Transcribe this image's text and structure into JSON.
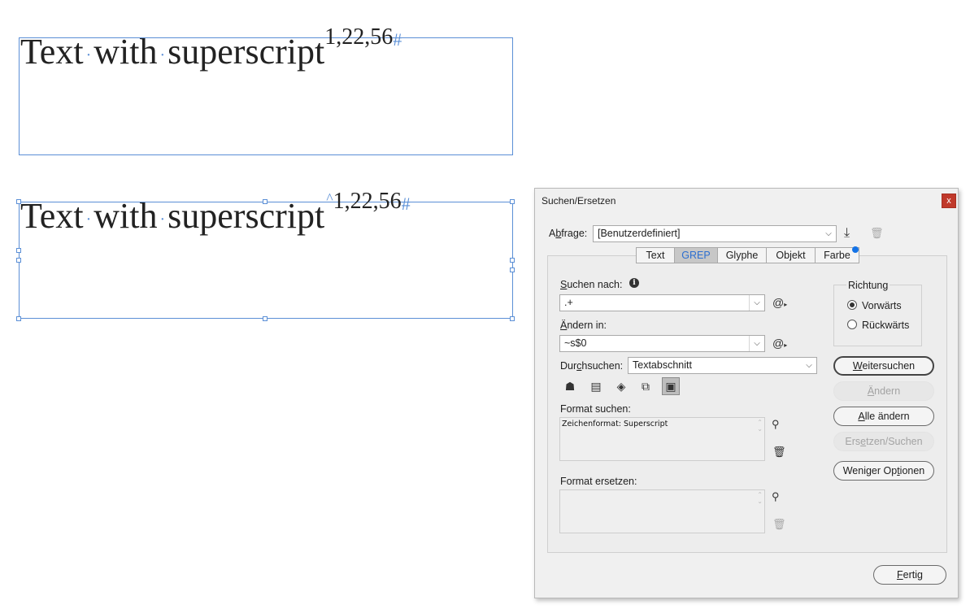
{
  "canvas": {
    "frame1": {
      "text": "Text",
      "word2": "with",
      "word3": "superscript",
      "superscript": "1,22,56",
      "end_marker": "#"
    },
    "frame2": {
      "text": "Text",
      "word2": "with",
      "word3": "superscript",
      "caret": "^",
      "superscript": "1,22,56",
      "end_marker": "#"
    },
    "space_marker": "·"
  },
  "dialog": {
    "title": "Suchen/Ersetzen",
    "close_glyph": "x",
    "query": {
      "label_pre": "A",
      "label_u": "b",
      "label_post": "frage:",
      "value": "[Benutzerdefiniert]"
    },
    "tabs": [
      "Text",
      "GREP",
      "Glyphe",
      "Objekt",
      "Farbe"
    ],
    "active_tab": "GREP",
    "find": {
      "label_pre": "",
      "label_u": "S",
      "label_post": "uchen nach:",
      "value": ".+",
      "info_glyph": "i"
    },
    "change": {
      "label_pre": "",
      "label_u": "Ä",
      "label_post": "ndern in:",
      "value": "~s$0"
    },
    "search_in": {
      "label_pre": "Dur",
      "label_u": "c",
      "label_post": "hsuchen:",
      "value": "Textabschnitt"
    },
    "find_format": {
      "label": "Format suchen:",
      "value": "Zeichenformat: Superscript"
    },
    "replace_format": {
      "label": "Format ersetzen:",
      "value": ""
    },
    "direction": {
      "title": "Richtung",
      "forward": "Vorwärts",
      "backward": "Rückwärts",
      "selected": "forward"
    },
    "buttons": {
      "find_next": {
        "pre": "",
        "u": "W",
        "post": "eitersuchen"
      },
      "change": {
        "pre": "",
        "u": "Ä",
        "post": "ndern"
      },
      "change_all": {
        "pre": "",
        "u": "A",
        "post": "lle ändern"
      },
      "change_find": {
        "pre": "Ers",
        "u": "e",
        "post": "tzen/Suchen"
      },
      "fewer_options": {
        "pre": "Weniger Op",
        "u": "t",
        "post": "ionen"
      },
      "done": {
        "pre": "",
        "u": "F",
        "post": "ertig"
      }
    },
    "icons": {
      "at_symbol": "@",
      "at_sub": "▸",
      "dropdown_arrow": "⌵",
      "save_query": "⤓",
      "delete_query": "🗑",
      "layer_lock": "☗",
      "master": "▤",
      "hidden_layers": "◈",
      "footnotes": "⧉",
      "case": "▣",
      "format_pick": "⚲",
      "format_clear": "🗑"
    },
    "colors": {
      "accent": "#1473e6",
      "active_tab_text": "#2d6fd0",
      "close_red": "#c0392b",
      "frame_blue": "#5b8fd6"
    }
  }
}
